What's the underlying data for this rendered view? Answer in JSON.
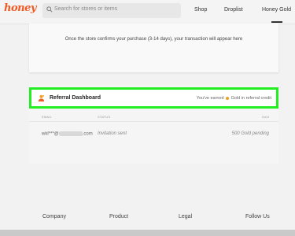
{
  "header": {
    "logo": "honey",
    "search_placeholder": "Search for stores or items",
    "nav": {
      "shop": "Shop",
      "droplist": "Droplist",
      "honey_gold": "Honey Gold"
    }
  },
  "purchases": {
    "message": "Once the store confirms your purchase (3-14 days), your transaction will appear here"
  },
  "referral": {
    "title": "Referral Dashboard",
    "earned_prefix": "You've earned",
    "earned_suffix": "Gold in referral credit",
    "columns": {
      "email": "EMAIL",
      "status": "STATUS",
      "gold": "Gold"
    },
    "rows": [
      {
        "email_prefix": "wkl***@",
        "email_suffix": ".com",
        "status": "Invitation sent",
        "gold": "500 Gold pending"
      }
    ]
  },
  "footer": {
    "company": "Company",
    "product": "Product",
    "legal": "Legal",
    "follow_us": "Follow Us"
  },
  "colors": {
    "brand": "#f15a24",
    "highlight": "#22ee22",
    "gold": "#e8a21a"
  }
}
